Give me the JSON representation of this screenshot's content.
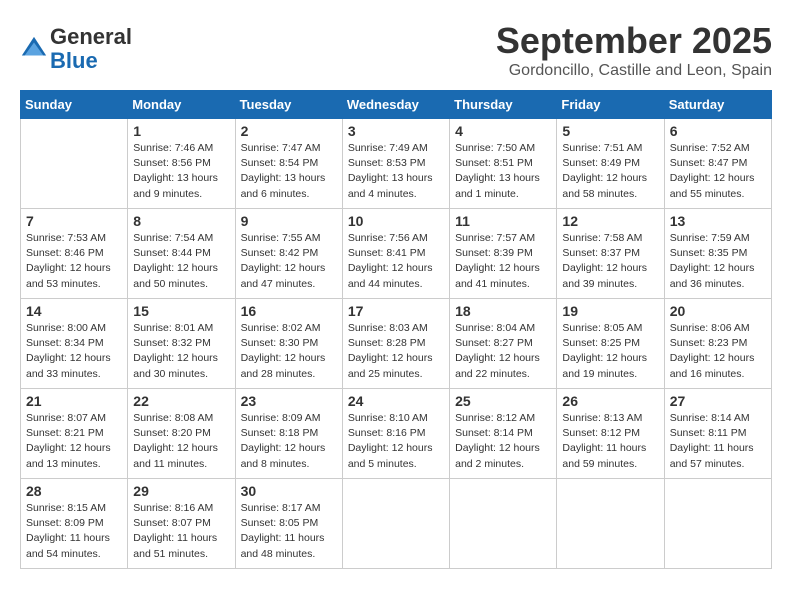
{
  "header": {
    "logo_line1": "General",
    "logo_line2": "Blue",
    "month_title": "September 2025",
    "location": "Gordoncillo, Castille and Leon, Spain"
  },
  "days_of_week": [
    "Sunday",
    "Monday",
    "Tuesday",
    "Wednesday",
    "Thursday",
    "Friday",
    "Saturday"
  ],
  "weeks": [
    [
      {
        "day": "",
        "info": ""
      },
      {
        "day": "1",
        "info": "Sunrise: 7:46 AM\nSunset: 8:56 PM\nDaylight: 13 hours\nand 9 minutes."
      },
      {
        "day": "2",
        "info": "Sunrise: 7:47 AM\nSunset: 8:54 PM\nDaylight: 13 hours\nand 6 minutes."
      },
      {
        "day": "3",
        "info": "Sunrise: 7:49 AM\nSunset: 8:53 PM\nDaylight: 13 hours\nand 4 minutes."
      },
      {
        "day": "4",
        "info": "Sunrise: 7:50 AM\nSunset: 8:51 PM\nDaylight: 13 hours\nand 1 minute."
      },
      {
        "day": "5",
        "info": "Sunrise: 7:51 AM\nSunset: 8:49 PM\nDaylight: 12 hours\nand 58 minutes."
      },
      {
        "day": "6",
        "info": "Sunrise: 7:52 AM\nSunset: 8:47 PM\nDaylight: 12 hours\nand 55 minutes."
      }
    ],
    [
      {
        "day": "7",
        "info": "Sunrise: 7:53 AM\nSunset: 8:46 PM\nDaylight: 12 hours\nand 53 minutes."
      },
      {
        "day": "8",
        "info": "Sunrise: 7:54 AM\nSunset: 8:44 PM\nDaylight: 12 hours\nand 50 minutes."
      },
      {
        "day": "9",
        "info": "Sunrise: 7:55 AM\nSunset: 8:42 PM\nDaylight: 12 hours\nand 47 minutes."
      },
      {
        "day": "10",
        "info": "Sunrise: 7:56 AM\nSunset: 8:41 PM\nDaylight: 12 hours\nand 44 minutes."
      },
      {
        "day": "11",
        "info": "Sunrise: 7:57 AM\nSunset: 8:39 PM\nDaylight: 12 hours\nand 41 minutes."
      },
      {
        "day": "12",
        "info": "Sunrise: 7:58 AM\nSunset: 8:37 PM\nDaylight: 12 hours\nand 39 minutes."
      },
      {
        "day": "13",
        "info": "Sunrise: 7:59 AM\nSunset: 8:35 PM\nDaylight: 12 hours\nand 36 minutes."
      }
    ],
    [
      {
        "day": "14",
        "info": "Sunrise: 8:00 AM\nSunset: 8:34 PM\nDaylight: 12 hours\nand 33 minutes."
      },
      {
        "day": "15",
        "info": "Sunrise: 8:01 AM\nSunset: 8:32 PM\nDaylight: 12 hours\nand 30 minutes."
      },
      {
        "day": "16",
        "info": "Sunrise: 8:02 AM\nSunset: 8:30 PM\nDaylight: 12 hours\nand 28 minutes."
      },
      {
        "day": "17",
        "info": "Sunrise: 8:03 AM\nSunset: 8:28 PM\nDaylight: 12 hours\nand 25 minutes."
      },
      {
        "day": "18",
        "info": "Sunrise: 8:04 AM\nSunset: 8:27 PM\nDaylight: 12 hours\nand 22 minutes."
      },
      {
        "day": "19",
        "info": "Sunrise: 8:05 AM\nSunset: 8:25 PM\nDaylight: 12 hours\nand 19 minutes."
      },
      {
        "day": "20",
        "info": "Sunrise: 8:06 AM\nSunset: 8:23 PM\nDaylight: 12 hours\nand 16 minutes."
      }
    ],
    [
      {
        "day": "21",
        "info": "Sunrise: 8:07 AM\nSunset: 8:21 PM\nDaylight: 12 hours\nand 13 minutes."
      },
      {
        "day": "22",
        "info": "Sunrise: 8:08 AM\nSunset: 8:20 PM\nDaylight: 12 hours\nand 11 minutes."
      },
      {
        "day": "23",
        "info": "Sunrise: 8:09 AM\nSunset: 8:18 PM\nDaylight: 12 hours\nand 8 minutes."
      },
      {
        "day": "24",
        "info": "Sunrise: 8:10 AM\nSunset: 8:16 PM\nDaylight: 12 hours\nand 5 minutes."
      },
      {
        "day": "25",
        "info": "Sunrise: 8:12 AM\nSunset: 8:14 PM\nDaylight: 12 hours\nand 2 minutes."
      },
      {
        "day": "26",
        "info": "Sunrise: 8:13 AM\nSunset: 8:12 PM\nDaylight: 11 hours\nand 59 minutes."
      },
      {
        "day": "27",
        "info": "Sunrise: 8:14 AM\nSunset: 8:11 PM\nDaylight: 11 hours\nand 57 minutes."
      }
    ],
    [
      {
        "day": "28",
        "info": "Sunrise: 8:15 AM\nSunset: 8:09 PM\nDaylight: 11 hours\nand 54 minutes."
      },
      {
        "day": "29",
        "info": "Sunrise: 8:16 AM\nSunset: 8:07 PM\nDaylight: 11 hours\nand 51 minutes."
      },
      {
        "day": "30",
        "info": "Sunrise: 8:17 AM\nSunset: 8:05 PM\nDaylight: 11 hours\nand 48 minutes."
      },
      {
        "day": "",
        "info": ""
      },
      {
        "day": "",
        "info": ""
      },
      {
        "day": "",
        "info": ""
      },
      {
        "day": "",
        "info": ""
      }
    ]
  ]
}
